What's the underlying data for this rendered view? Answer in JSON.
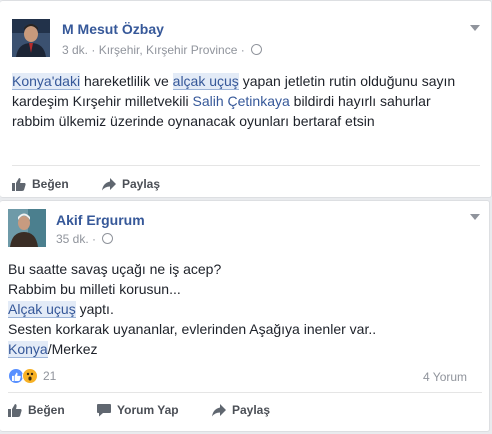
{
  "post1": {
    "author": "M Mesut Özbay",
    "time": "3 dk.",
    "location": "Kırşehir, Kırşehir Province",
    "text": {
      "t1": "Konya'daki",
      "t2": " hareketlilik ve ",
      "t3": "alçak uçuş",
      "t4": " yapan jetletin rutin olduğunu sayın",
      "t5": "kardeşim Kırşehir milletvekili ",
      "t6": "Salih Çetinkaya",
      "t7": " bildirdi hayırlı sahurlar",
      "t8": "rabbim ülkemiz üzerinde oynanacak oyunları bertaraf etsin"
    },
    "actions": {
      "like": "Beğen",
      "share": "Paylaş"
    }
  },
  "post2": {
    "author": "Akif Ergurum",
    "time": "35 dk.",
    "text": {
      "l1": "Bu saatte savaş uçağı ne iş acep?",
      "l2": "Rabbim bu milleti korusun...",
      "l3a": "Alçak uçuş",
      "l3b": " yaptı.",
      "l4": "Sesten korkarak uyananlar, evlerinden Aşağıya inenler var..",
      "l5a": "Konya",
      "l5b": "/Merkez"
    },
    "reactions": {
      "count": "21",
      "comments": "4 Yorum"
    },
    "actions": {
      "like": "Beğen",
      "comment": "Yorum Yap",
      "share": "Paylaş"
    }
  },
  "colors": {
    "link": "#365899",
    "highlight": "#e3ebf7",
    "like_blue": "#5890ff",
    "wow_yellow": "#f7b125"
  },
  "icons": [
    "like-icon",
    "share-icon",
    "comment-icon",
    "globe-icon",
    "chevron-down-icon",
    "like-reaction-icon",
    "wow-reaction-icon"
  ]
}
